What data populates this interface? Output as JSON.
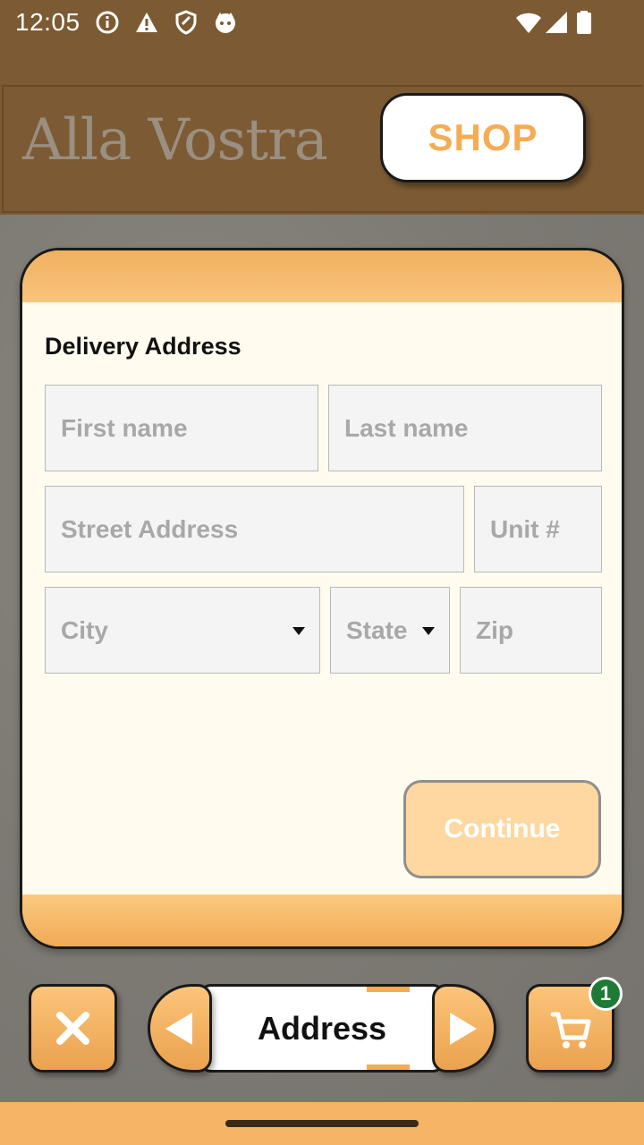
{
  "status_bar": {
    "time": "12:05",
    "icons": [
      "info-icon",
      "warning-icon",
      "shield-icon",
      "cat-icon",
      "wifi-icon",
      "signal-icon",
      "battery-icon"
    ]
  },
  "header": {
    "brand": "Alla Vostra",
    "shop_label": "SHOP"
  },
  "form": {
    "title": "Delivery Address",
    "first_name_placeholder": "First name",
    "last_name_placeholder": "Last name",
    "street_placeholder": "Street Address",
    "unit_placeholder": "Unit #",
    "city_placeholder": "City",
    "state_placeholder": "State",
    "zip_placeholder": "Zip",
    "continue_label": "Continue"
  },
  "bottom_bar": {
    "step_label": "Address",
    "cart_count": "1",
    "close_icon": "close-icon",
    "cart_icon": "cart-icon"
  },
  "colors": {
    "header_bg": "#7c5a33",
    "accent": "#f4ac55",
    "card_bg": "#fffcef",
    "badge": "#1e7a35"
  }
}
